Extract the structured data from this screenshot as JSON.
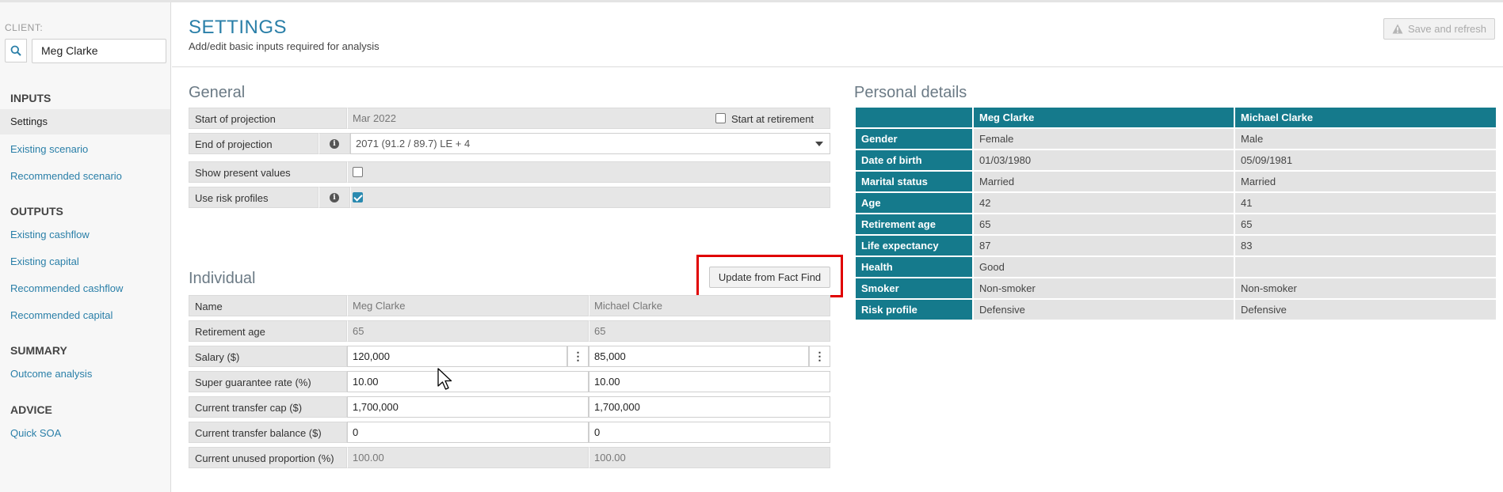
{
  "sidebar": {
    "client_label": "CLIENT:",
    "client_value": "Meg Clarke",
    "sections": {
      "inputs": "INPUTS",
      "outputs": "OUTPUTS",
      "summary": "SUMMARY",
      "advice": "ADVICE"
    },
    "items": {
      "settings": "Settings",
      "existing_scenario": "Existing scenario",
      "recommended_scenario": "Recommended scenario",
      "existing_cashflow": "Existing cashflow",
      "existing_capital": "Existing capital",
      "recommended_cashflow": "Recommended cashflow",
      "recommended_capital": "Recommended capital",
      "outcome_analysis": "Outcome analysis",
      "quick_soa": "Quick SOA"
    }
  },
  "header": {
    "title": "SETTINGS",
    "subtitle": "Add/edit basic inputs required for analysis",
    "save_label": "Save and refresh"
  },
  "general": {
    "heading": "General",
    "start_label": "Start of projection",
    "start_value": "Mar 2022",
    "start_at_retirement_label": "Start at retirement",
    "end_label": "End of projection",
    "end_value": "2071 (91.2 / 89.7) LE + 4",
    "present_values_label": "Show present values",
    "present_values_checked": false,
    "risk_profiles_label": "Use risk profiles",
    "risk_profiles_checked": true
  },
  "individual": {
    "heading": "Individual",
    "update_button": "Update from Fact Find",
    "rows": [
      {
        "label": "Name",
        "a": "Meg Clarke",
        "b": "Michael Clarke"
      },
      {
        "label": "Retirement age",
        "a": "65",
        "b": "65"
      },
      {
        "label": "Salary ($)",
        "a": "120,000",
        "b": "85,000"
      },
      {
        "label": "Super guarantee rate (%)",
        "a": "10.00",
        "b": "10.00"
      },
      {
        "label": "Current transfer cap ($)",
        "a": "1,700,000",
        "b": "1,700,000"
      },
      {
        "label": "Current transfer balance ($)",
        "a": "0",
        "b": "0"
      },
      {
        "label": "Current unused proportion (%)",
        "a": "100.00",
        "b": "100.00"
      }
    ]
  },
  "personal_details": {
    "heading": "Personal details",
    "columns": [
      "",
      "Meg Clarke",
      "Michael Clarke"
    ],
    "rows": [
      {
        "label": "Gender",
        "a": "Female",
        "b": "Male"
      },
      {
        "label": "Date of birth",
        "a": "01/03/1980",
        "b": "05/09/1981"
      },
      {
        "label": "Marital status",
        "a": "Married",
        "b": "Married"
      },
      {
        "label": "Age",
        "a": "42",
        "b": "41"
      },
      {
        "label": "Retirement age",
        "a": "65",
        "b": "65"
      },
      {
        "label": "Life expectancy",
        "a": "87",
        "b": "83"
      },
      {
        "label": "Health",
        "a": "Good",
        "b": ""
      },
      {
        "label": "Smoker",
        "a": "Non-smoker",
        "b": "Non-smoker"
      },
      {
        "label": "Risk profile",
        "a": "Defensive",
        "b": "Defensive"
      }
    ]
  },
  "colors": {
    "accent": "#2a7fa8",
    "table_header": "#157a8c",
    "highlight": "#e00000"
  }
}
